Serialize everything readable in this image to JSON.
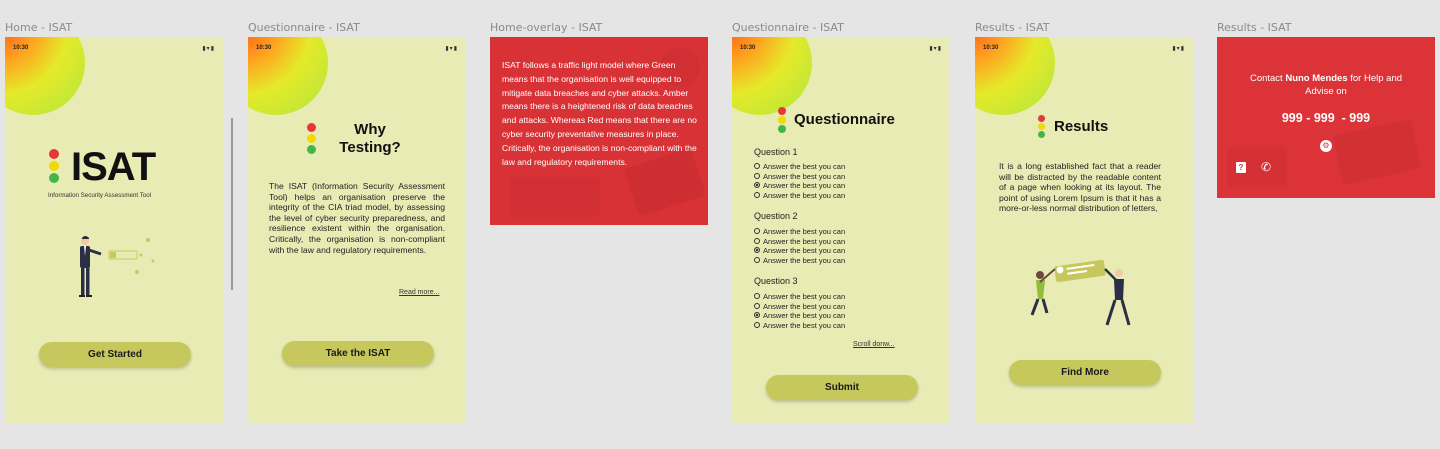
{
  "labels": [
    "Home - ISAT",
    "Questionnaire - ISAT",
    "Home-overlay - ISAT",
    "Questionnaire - ISAT",
    "Results - ISAT",
    "Results - ISAT"
  ],
  "status_time": "10:30",
  "status_icons": "▮▾▮",
  "home": {
    "title": "ISAT",
    "subtitle": "Information Security Assessment Tool",
    "cta": "Get Started"
  },
  "why": {
    "title": "Why Testing?",
    "body": "The ISAT (Information Security Assessment Tool) helps an organisation preserve the integrity of the CIA triad model, by assessing the level of cyber security preparedness, and resilience existent within the organisation. Critically, the organisation is non-compliant with the law and regulatory requirements.",
    "read_more": "Read more...",
    "cta": "Take the ISAT"
  },
  "overlay": {
    "text": "ISAT follows a traffic light model where Green means that the organisation is well equipped to mitigate data breaches and cyber attacks. Amber means there is a heightened risk of data breaches and attacks. Whereas Red means that there are no cyber security preventative measures in place. Critically, the organisation is non-compliant with the law and regulatory requirements."
  },
  "questionnaire": {
    "title": "Questionnaire",
    "questions": [
      {
        "label": "Question 1",
        "options": [
          "Answer the best you can",
          "Answer the best you can",
          "Answer the best you can",
          "Answer the best you can"
        ],
        "selected": 2
      },
      {
        "label": "Question 2",
        "options": [
          "Answer the best you can",
          "Answer the best you can",
          "Answer the best you can",
          "Answer the best you can"
        ],
        "selected": 2
      },
      {
        "label": "Question 3",
        "options": [
          "Answer the best you can",
          "Answer the best you can",
          "Answer the best you can",
          "Answer the best you can"
        ],
        "selected": 2
      }
    ],
    "scroll": "Scroll donw...",
    "cta": "Submit"
  },
  "results": {
    "title": "Results",
    "body": "It is a long established fact that a reader will be distracted by the readable content of a page when looking at its layout. The point of using Lorem Ipsum is that it has a more-or-less normal distribution of letters,",
    "cta": "Find More"
  },
  "contact": {
    "prefix": "Contact ",
    "name": "Nuno Mendes",
    "suffix": " for Help and Advise on",
    "phone": "999 - 999  - 999"
  },
  "colors": {
    "red": "#e53935",
    "amber": "#f2d900",
    "green": "#43b649",
    "frame": "#e9ebb4",
    "button": "#c6c85d"
  }
}
